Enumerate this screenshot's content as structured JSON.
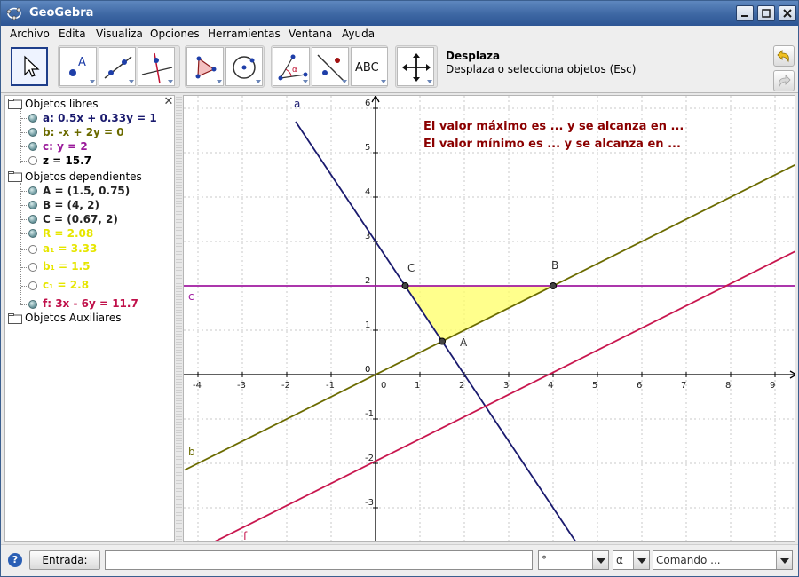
{
  "window": {
    "title": "GeoGebra"
  },
  "menu": [
    "Archivo",
    "Edita",
    "Visualiza",
    "Opciones",
    "Herramientas",
    "Ventana",
    "Ayuda"
  ],
  "toolbar": {
    "active_tool": "move",
    "tools": [
      "move",
      "point",
      "line",
      "perpendicular-line",
      "polygon",
      "circle",
      "angle",
      "reflect",
      "text",
      "move-graphics-view"
    ],
    "text_tool_label": "ABC",
    "help_title": "Desplaza",
    "help_desc": "Desplaza o selecciona objetos (Esc)"
  },
  "algebra": {
    "free": {
      "label": "Objetos libres",
      "items": [
        {
          "text": "a: 0.5x + 0.33y = 1",
          "color": "#1a1a6e",
          "shown": true
        },
        {
          "text": "b: -x + 2y = 0",
          "color": "#6b6b00",
          "shown": true
        },
        {
          "text": "c: y = 2",
          "color": "#9a1a9a",
          "shown": true
        },
        {
          "text": "z = 15.7",
          "color": "#000000",
          "shown": false
        }
      ]
    },
    "dependent": {
      "label": "Objetos dependientes",
      "items": [
        {
          "text": "A = (1.5, 0.75)",
          "color": "#222222",
          "shown": true
        },
        {
          "text": "B = (4, 2)",
          "color": "#222222",
          "shown": true
        },
        {
          "text": "C = (0.67, 2)",
          "color": "#222222",
          "shown": true
        },
        {
          "text": "R = 2.08",
          "color": "#e6e600",
          "shown": true
        },
        {
          "text": "a₁ = 3.33",
          "color": "#e6e600",
          "shown": false
        },
        {
          "text": "b₁ = 1.5",
          "color": "#e6e600",
          "shown": false
        },
        {
          "text": "c₁ = 2.8",
          "color": "#e6e600",
          "shown": false
        },
        {
          "text": "f: 3x - 6y = 11.7",
          "color": "#c0104a",
          "shown": true
        }
      ]
    },
    "aux": {
      "label": "Objetos Auxiliares"
    }
  },
  "graphics": {
    "texts": [
      "El valor máximo es ... y se alcanza en ...",
      "El valor mínimo es ... y se alcanza en ..."
    ],
    "text_color": "#8b0000",
    "labels": {
      "a": "a",
      "b": "b",
      "c": "c",
      "f": "f",
      "A": "A",
      "B": "B",
      "C": "C"
    },
    "x_ticks": [
      "-4",
      "-3",
      "-2",
      "-1",
      "0",
      "1",
      "2",
      "3",
      "4",
      "5",
      "6",
      "7",
      "8",
      "9"
    ],
    "y_ticks": [
      "-3",
      "-2",
      "-1",
      "1",
      "2",
      "3",
      "4",
      "5",
      "6"
    ],
    "colors": {
      "a": "#1a1a6e",
      "b": "#6b6b00",
      "c": "#a01aa0",
      "f": "#c8164e",
      "region": "#ffff66"
    }
  },
  "bottom": {
    "input_label": "Entrada:",
    "degree": "°",
    "alpha": "α",
    "command": "Comando ..."
  }
}
